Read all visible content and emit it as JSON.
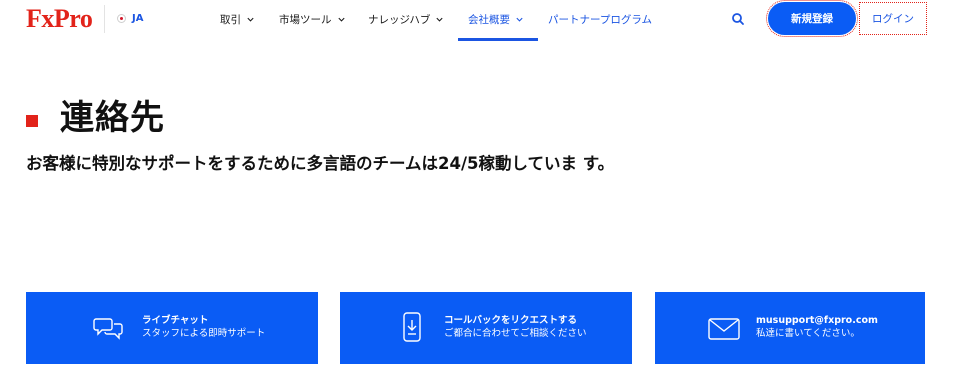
{
  "header": {
    "logo": "FxPro",
    "language": "JA",
    "nav": [
      {
        "label": "取引",
        "has_dropdown": true
      },
      {
        "label": "市場ツール",
        "has_dropdown": true
      },
      {
        "label": "ナレッジハブ",
        "has_dropdown": true
      },
      {
        "label": "会社概要",
        "has_dropdown": true,
        "active": true
      },
      {
        "label": "パートナープログラム",
        "has_dropdown": false
      }
    ],
    "register_label": "新規登録",
    "login_label": "ログイン"
  },
  "hero": {
    "title": "連絡先",
    "subtitle": "お客様に特別なサポートをするために多言語のチームは24/5稼動していま す。"
  },
  "cards": [
    {
      "icon": "chat-bubbles-icon",
      "title": "ライブチャット",
      "subtitle": "スタッフによる即時サポート"
    },
    {
      "icon": "phone-download-icon",
      "title": "コールバックをリクエストする",
      "subtitle": "ご都合に合わせてご相談ください"
    },
    {
      "icon": "envelope-icon",
      "title": "musupport@fxpro.com",
      "subtitle": "私達に書いてください。"
    }
  ],
  "colors": {
    "brand_red": "#e2231a",
    "primary_blue": "#0a5cf5",
    "link_blue": "#1b55e2"
  }
}
